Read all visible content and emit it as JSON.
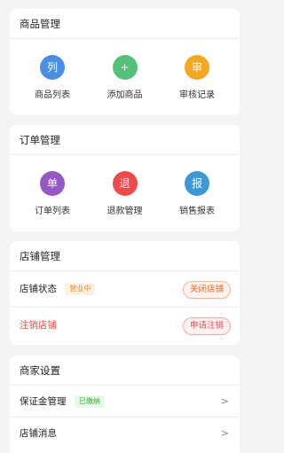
{
  "product": {
    "title": "商品管理",
    "items": [
      {
        "icon": "列",
        "label": "商品列表",
        "color": "#4a8fe2"
      },
      {
        "icon": "+",
        "label": "添加商品",
        "color": "#56c07a"
      },
      {
        "icon": "审",
        "label": "审核记录",
        "color": "#f5a623"
      }
    ]
  },
  "order": {
    "title": "订单管理",
    "items": [
      {
        "icon": "单",
        "label": "订单列表",
        "color": "#9457c4"
      },
      {
        "icon": "退",
        "label": "退款管理",
        "color": "#ef4a4a"
      },
      {
        "icon": "报",
        "label": "销售报表",
        "color": "#3d98d8"
      }
    ]
  },
  "store": {
    "title": "店铺管理",
    "status_label": "店铺状态",
    "status_badge": "营业中",
    "close_button": "关闭店铺",
    "cancel_label": "注销店铺",
    "cancel_button": "申请注销"
  },
  "merchant": {
    "title": "商家设置",
    "deposit_label": "保证金管理",
    "deposit_badge": "已缴纳",
    "deposit_chevron": ">",
    "message_label": "店铺消息",
    "message_chevron": ">"
  }
}
